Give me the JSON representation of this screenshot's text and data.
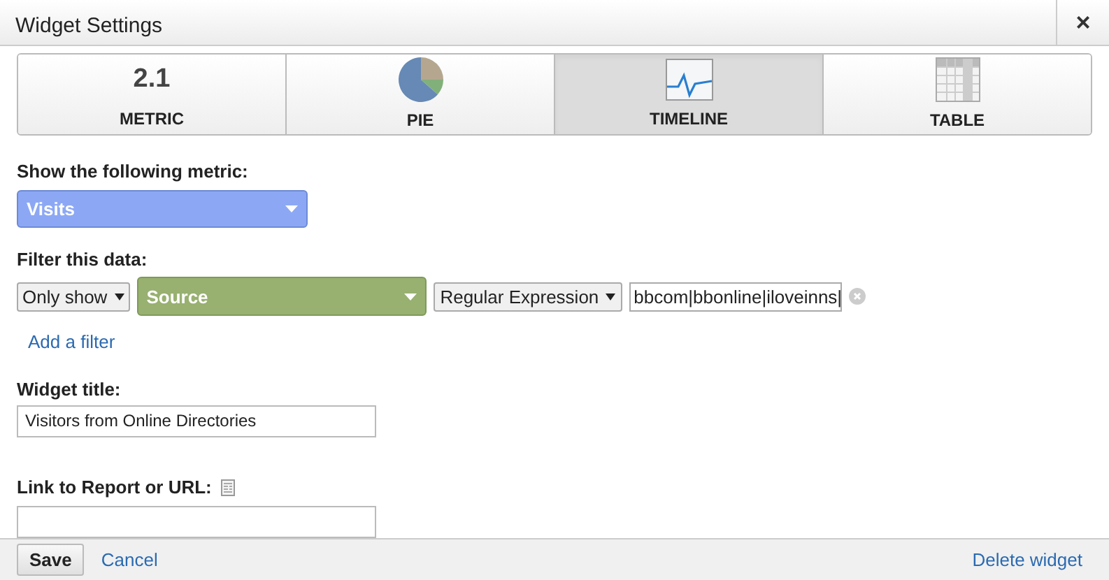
{
  "window": {
    "title": "Widget Settings",
    "close": "×"
  },
  "tabs": [
    {
      "kind": "metric",
      "icon_text": "2.1",
      "label": "METRIC",
      "selected": false
    },
    {
      "kind": "pie",
      "label": "PIE",
      "selected": false
    },
    {
      "kind": "timeline",
      "label": "TIMELINE",
      "selected": true
    },
    {
      "kind": "table",
      "label": "TABLE",
      "selected": false
    }
  ],
  "metric": {
    "label": "Show the following metric:",
    "value": "Visits"
  },
  "filter": {
    "label": "Filter this data:",
    "mode": "Only show",
    "dimension": "Source",
    "match": "Regular Expression",
    "value": "bbcom|bbonline|iloveinns|",
    "add_link": "Add a filter"
  },
  "widget_title": {
    "label": "Widget title:",
    "value": "Visitors from Online Directories"
  },
  "link": {
    "label": "Link to Report or URL:"
  },
  "footer": {
    "save": "Save",
    "cancel": "Cancel",
    "delete": "Delete widget"
  }
}
